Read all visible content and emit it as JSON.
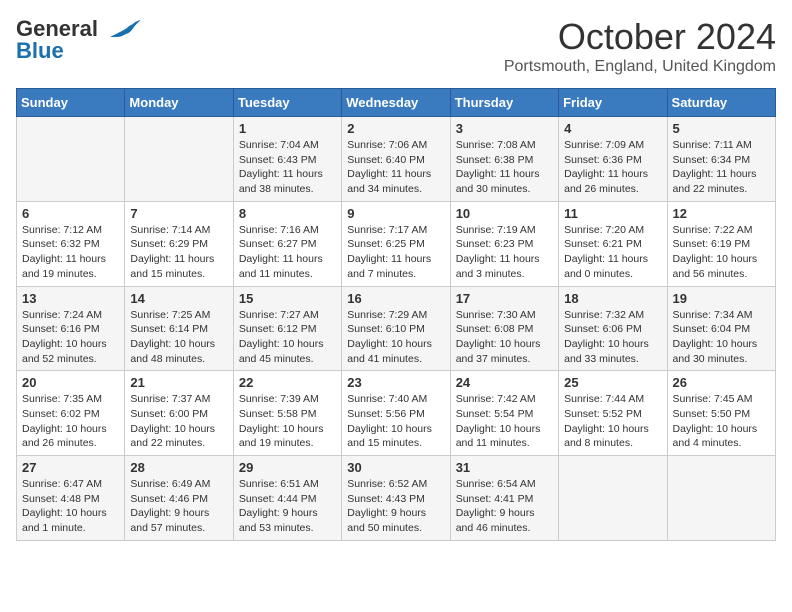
{
  "header": {
    "logo_line1": "General",
    "logo_line2": "Blue",
    "month": "October 2024",
    "location": "Portsmouth, England, United Kingdom"
  },
  "days_of_week": [
    "Sunday",
    "Monday",
    "Tuesday",
    "Wednesday",
    "Thursday",
    "Friday",
    "Saturday"
  ],
  "weeks": [
    [
      {
        "day": "",
        "info": ""
      },
      {
        "day": "",
        "info": ""
      },
      {
        "day": "1",
        "info": "Sunrise: 7:04 AM\nSunset: 6:43 PM\nDaylight: 11 hours and 38 minutes."
      },
      {
        "day": "2",
        "info": "Sunrise: 7:06 AM\nSunset: 6:40 PM\nDaylight: 11 hours and 34 minutes."
      },
      {
        "day": "3",
        "info": "Sunrise: 7:08 AM\nSunset: 6:38 PM\nDaylight: 11 hours and 30 minutes."
      },
      {
        "day": "4",
        "info": "Sunrise: 7:09 AM\nSunset: 6:36 PM\nDaylight: 11 hours and 26 minutes."
      },
      {
        "day": "5",
        "info": "Sunrise: 7:11 AM\nSunset: 6:34 PM\nDaylight: 11 hours and 22 minutes."
      }
    ],
    [
      {
        "day": "6",
        "info": "Sunrise: 7:12 AM\nSunset: 6:32 PM\nDaylight: 11 hours and 19 minutes."
      },
      {
        "day": "7",
        "info": "Sunrise: 7:14 AM\nSunset: 6:29 PM\nDaylight: 11 hours and 15 minutes."
      },
      {
        "day": "8",
        "info": "Sunrise: 7:16 AM\nSunset: 6:27 PM\nDaylight: 11 hours and 11 minutes."
      },
      {
        "day": "9",
        "info": "Sunrise: 7:17 AM\nSunset: 6:25 PM\nDaylight: 11 hours and 7 minutes."
      },
      {
        "day": "10",
        "info": "Sunrise: 7:19 AM\nSunset: 6:23 PM\nDaylight: 11 hours and 3 minutes."
      },
      {
        "day": "11",
        "info": "Sunrise: 7:20 AM\nSunset: 6:21 PM\nDaylight: 11 hours and 0 minutes."
      },
      {
        "day": "12",
        "info": "Sunrise: 7:22 AM\nSunset: 6:19 PM\nDaylight: 10 hours and 56 minutes."
      }
    ],
    [
      {
        "day": "13",
        "info": "Sunrise: 7:24 AM\nSunset: 6:16 PM\nDaylight: 10 hours and 52 minutes."
      },
      {
        "day": "14",
        "info": "Sunrise: 7:25 AM\nSunset: 6:14 PM\nDaylight: 10 hours and 48 minutes."
      },
      {
        "day": "15",
        "info": "Sunrise: 7:27 AM\nSunset: 6:12 PM\nDaylight: 10 hours and 45 minutes."
      },
      {
        "day": "16",
        "info": "Sunrise: 7:29 AM\nSunset: 6:10 PM\nDaylight: 10 hours and 41 minutes."
      },
      {
        "day": "17",
        "info": "Sunrise: 7:30 AM\nSunset: 6:08 PM\nDaylight: 10 hours and 37 minutes."
      },
      {
        "day": "18",
        "info": "Sunrise: 7:32 AM\nSunset: 6:06 PM\nDaylight: 10 hours and 33 minutes."
      },
      {
        "day": "19",
        "info": "Sunrise: 7:34 AM\nSunset: 6:04 PM\nDaylight: 10 hours and 30 minutes."
      }
    ],
    [
      {
        "day": "20",
        "info": "Sunrise: 7:35 AM\nSunset: 6:02 PM\nDaylight: 10 hours and 26 minutes."
      },
      {
        "day": "21",
        "info": "Sunrise: 7:37 AM\nSunset: 6:00 PM\nDaylight: 10 hours and 22 minutes."
      },
      {
        "day": "22",
        "info": "Sunrise: 7:39 AM\nSunset: 5:58 PM\nDaylight: 10 hours and 19 minutes."
      },
      {
        "day": "23",
        "info": "Sunrise: 7:40 AM\nSunset: 5:56 PM\nDaylight: 10 hours and 15 minutes."
      },
      {
        "day": "24",
        "info": "Sunrise: 7:42 AM\nSunset: 5:54 PM\nDaylight: 10 hours and 11 minutes."
      },
      {
        "day": "25",
        "info": "Sunrise: 7:44 AM\nSunset: 5:52 PM\nDaylight: 10 hours and 8 minutes."
      },
      {
        "day": "26",
        "info": "Sunrise: 7:45 AM\nSunset: 5:50 PM\nDaylight: 10 hours and 4 minutes."
      }
    ],
    [
      {
        "day": "27",
        "info": "Sunrise: 6:47 AM\nSunset: 4:48 PM\nDaylight: 10 hours and 1 minute."
      },
      {
        "day": "28",
        "info": "Sunrise: 6:49 AM\nSunset: 4:46 PM\nDaylight: 9 hours and 57 minutes."
      },
      {
        "day": "29",
        "info": "Sunrise: 6:51 AM\nSunset: 4:44 PM\nDaylight: 9 hours and 53 minutes."
      },
      {
        "day": "30",
        "info": "Sunrise: 6:52 AM\nSunset: 4:43 PM\nDaylight: 9 hours and 50 minutes."
      },
      {
        "day": "31",
        "info": "Sunrise: 6:54 AM\nSunset: 4:41 PM\nDaylight: 9 hours and 46 minutes."
      },
      {
        "day": "",
        "info": ""
      },
      {
        "day": "",
        "info": ""
      }
    ]
  ]
}
